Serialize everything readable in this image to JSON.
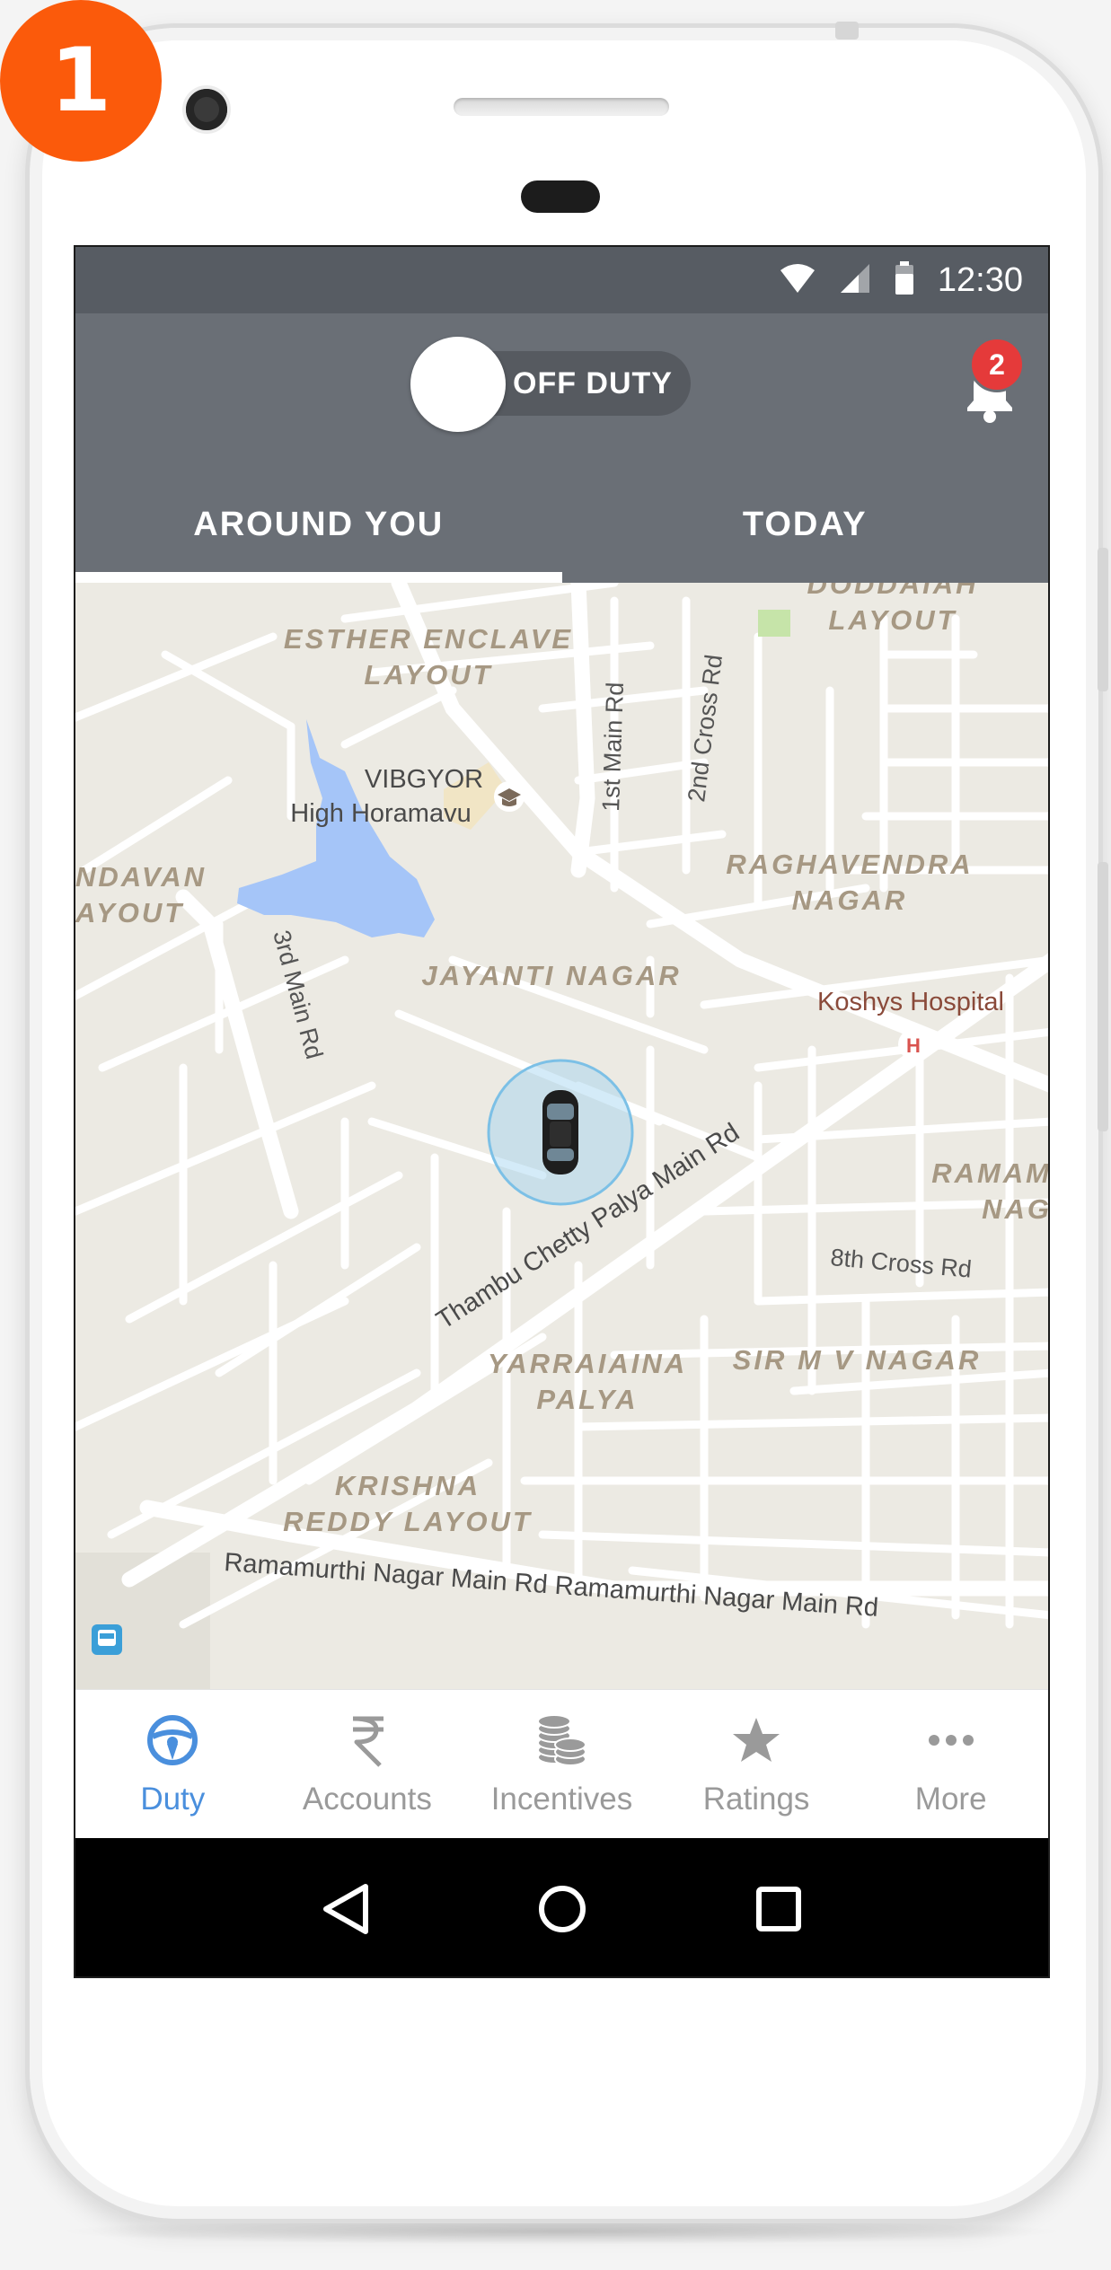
{
  "step_badge": "1",
  "status_bar": {
    "time": "12:30"
  },
  "header": {
    "duty_toggle_label": "OFF DUTY",
    "notification_count": "2"
  },
  "tabs": [
    {
      "label": "AROUND YOU",
      "active": true
    },
    {
      "label": "TODAY",
      "active": false
    }
  ],
  "map": {
    "labels": {
      "doddaiah": "DODDAIAH",
      "doddaiah_layout": "LAYOUT",
      "esther_enclave": "ESTHER ENCLAVE",
      "esther_layout": "LAYOUT",
      "vibgyor": "VIBGYOR",
      "high_horamavu": "High Horamavu",
      "first_main_rd": "1st Main Rd",
      "second_cross_rd": "2nd Cross Rd",
      "ndavan": "NDAVAN",
      "ayout": "AYOUT",
      "raghavendra": "RAGHAVENDRA",
      "raghavendra_nagar": "NAGAR",
      "third_main_rd": "3rd Main Rd",
      "jayanti_nagar": "JAYANTI NAGAR",
      "koshys_hospital": "Koshys Hospital",
      "ramam": "RAMAM",
      "nag": "NAG",
      "thambu_road": "Thambu Chetty Palya Main Rd",
      "eighth_cross_rd": "8th Cross Rd",
      "yarraiaina": "YARRAIAINA",
      "palya": "PALYA",
      "sir_mv_nagar": "SIR M V NAGAR",
      "krishna": "KRISHNA",
      "reddy_layout": "REDDY LAYOUT",
      "ramamurthi_road": "Ramamurthi Nagar Main Rd Ramamurthi Nagar Main Rd"
    }
  },
  "bottom_nav": [
    {
      "label": "Duty",
      "icon": "steering-wheel-icon",
      "active": true
    },
    {
      "label": "Accounts",
      "icon": "rupee-icon",
      "active": false
    },
    {
      "label": "Incentives",
      "icon": "coin-stack-icon",
      "active": false
    },
    {
      "label": "Ratings",
      "icon": "star-icon",
      "active": false
    },
    {
      "label": "More",
      "icon": "more-dots-icon",
      "active": false
    }
  ],
  "colors": {
    "accent": "#4a8fdd",
    "header": "#6a6f76",
    "status_bar": "#575c63",
    "badge": "#e53a3a",
    "step_badge": "#fb5a0b",
    "map_background": "#eceae3",
    "water": "#a5c5f8"
  }
}
